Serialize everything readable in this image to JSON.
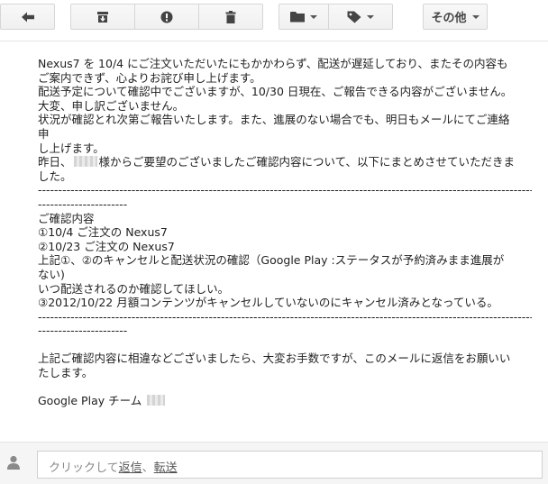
{
  "toolbar": {
    "icons": {
      "back": "back-arrow-icon",
      "archive": "archive-icon",
      "spam": "report-spam-icon",
      "delete": "trash-icon",
      "move": "folder-icon",
      "labels": "label-tag-icon"
    },
    "more_label": "その他"
  },
  "message": {
    "lines": [
      "Nexus7 を 10/4 にご注文いただいたにもかかわらず、配送が遅延しており、またその内容も",
      "ご案内できず、心よりお詫び申し上げます。",
      "配送予定について確認中でございますが、10/30 日現在、ご報告できる内容がございません。",
      "大変、申し訳ございません。",
      "状況が確認とれ次第ご報告いたします。また、進展のない場合でも、明日もメールにてご連絡",
      "申",
      "し上げます。"
    ],
    "request_line_prefix": "昨日、",
    "request_line_suffix": "様からご要望のございましたご確認内容について、以下にまとめさせていただきま",
    "request_line_end": "した。",
    "separator_long": "------------------------------------------------------------------------------------------------------------------------------------",
    "separator_short": "----------------------",
    "details": [
      "ご確認内容",
      "①10/4 ご注文の Nexus7",
      "②10/23 ご注文の Nexus7",
      "上記①、②のキャンセルと配送状況の確認（Google Play :ステータスが予約済みまま進展が",
      "ない)",
      "いつ配送されるのか確認してほしい。",
      "③2012/10/22 月額コンテンツがキャンセルしていないのにキャンセル済みとなっている。"
    ],
    "closing": [
      "上記ご確認内容に相違などございましたら、大変お手数ですが、このメールに返信をお願いい",
      "たします。"
    ],
    "signature": "Google Play チーム"
  },
  "reply": {
    "avatar_icon": "person-icon",
    "prefix": "クリックして",
    "reply_link": "返信",
    "separator": "、",
    "forward_link": "転送"
  },
  "colors": {
    "text": "#222222",
    "toolbar_button_border": "#d6d6d6",
    "reply_background": "#f5f5f5"
  }
}
